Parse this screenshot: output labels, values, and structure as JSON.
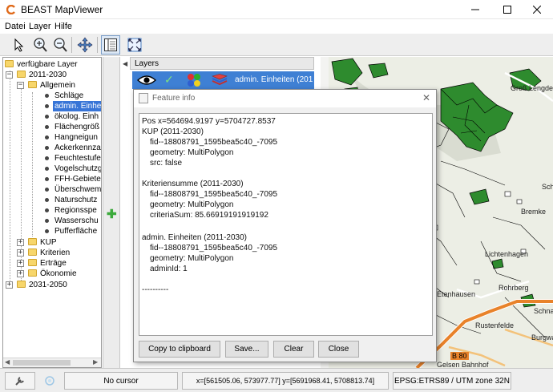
{
  "window": {
    "title": "BEAST MapViewer"
  },
  "menu": {
    "items": [
      "Datei",
      "Layer",
      "Hilfe"
    ]
  },
  "toolbar": {
    "tools": [
      "select-arrow-icon",
      "zoom-in-icon",
      "zoom-out-icon",
      "pan-icon",
      "layer-panel-icon",
      "zoom-extent-icon"
    ],
    "active_tool": "layer-panel-icon"
  },
  "tree": {
    "root": "verfügbare Layer",
    "group_2011": "2011-2030",
    "allgemein": "Allgemein",
    "items": [
      "Schläge",
      "admin. Einhe",
      "ökolog. Einh",
      "Flächengröß",
      "Hangneigun",
      "Ackerkennza",
      "Feuchtestufe",
      "Vogelschutzg",
      "FFH-Gebiete",
      "Überschwem",
      "Naturschutz",
      "Regionsspe",
      "Wasserschu",
      "Pufferfläche"
    ],
    "selected_index": 1,
    "subgroups": [
      "KUP",
      "Kriterien",
      "Erträge",
      "Ökonomie"
    ],
    "group_2031": "2031-2050"
  },
  "layers": {
    "header": "Layers",
    "row_label": "admin. Einheiten (201"
  },
  "map": {
    "labels": [
      "Groß Lengde",
      "Bremke",
      "Lichtenhagen",
      "Rohrberg",
      "Rustenfelde",
      "Schna",
      "Burgwa",
      "Schö",
      "Etenhausen",
      "B 80",
      "Gelsen Bahnhof"
    ],
    "colors": {
      "forest": "#2e8b2e",
      "road": "#e8822a",
      "background": "#eceee5"
    }
  },
  "dialog": {
    "title": "Feature info",
    "lines": [
      "Pos x=564694.9197 y=5704727.8537",
      "KUP (2011-2030)",
      "fid--18808791_1595bea5c40_-7095",
      "geometry: MultiPolygon",
      "src: false",
      "",
      "Kriteriensumme (2011-2030)",
      "fid--18808791_1595bea5c40_-7095",
      "geometry: MultiPolygon",
      "criteriaSum: 85.66919191919192",
      "",
      "admin. Einheiten (2011-2030)",
      "fid--18808791_1595bea5c40_-7095",
      "geometry: MultiPolygon",
      "adminId: 1",
      "",
      "----------"
    ],
    "buttons": {
      "copy": "Copy to clipboard",
      "save": "Save...",
      "clear": "Clear",
      "close": "Close"
    }
  },
  "status": {
    "cursor": "No cursor",
    "extent": "x=[561505.06, 573977.77] y=[5691968.41, 5708813.74]",
    "crs": "EPSG:ETRS89 / UTM zone 32N"
  }
}
